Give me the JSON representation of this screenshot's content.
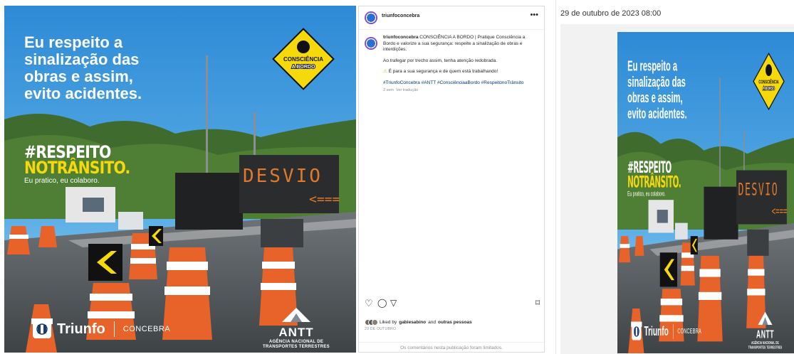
{
  "poster": {
    "headline": [
      "Eu respeito a",
      "sinalização das",
      "obras e assim,",
      "evito acidentes."
    ],
    "badge": [
      "CONSCIÊNCIA",
      "A BORDO"
    ],
    "hashtag_line1": "#RESPEITO",
    "hashtag_line2": "NOTRÂNSITO.",
    "tagline": "Eu pratico, eu colaboro.",
    "sign_text": "DESVIO",
    "brand_name": "Triunfo",
    "brand_partner": "CONCEBRA",
    "agency_name": "ANTT",
    "agency_full": [
      "AGÊNCIA NACIONAL DE",
      "TRANSPORTES TERRESTRES"
    ]
  },
  "post": {
    "username": "triunfoconcebra",
    "more_icon": "more-horizontal-icon",
    "caption_title": "CONSCIÊNCIA A BORDO | Pratique Consciência a Bordo e valorize a sua segurança: respeite a sinalização de obras e interdições.",
    "caption_p2": "Ao trafegar por trecho assim, tenha atenção redobrada.",
    "caption_p3": "É para a sua segurança e de quem está trabalhando!",
    "hashtags": "#TriunfoConcebra #ANTT #ConsciênciaaBordo #RespeitonoTrânsito",
    "time_ago": "2 sem",
    "translate_label": "Ver tradução",
    "liked_prefix": "Liked by ",
    "liked_user": "gabiesabino",
    "liked_and": " and ",
    "liked_others": "outras pessoas",
    "post_date": "29 DE OUTUBRO",
    "comments_disabled": "Os comentários nesta publicação foram limitados."
  },
  "right": {
    "timestamp": "29 de outubro de 2023 08:00"
  },
  "colors": {
    "sky": "#3b97e0",
    "accent_yellow": "#f5d90a",
    "cone_orange": "#e8632a",
    "link_blue": "#00376b"
  }
}
